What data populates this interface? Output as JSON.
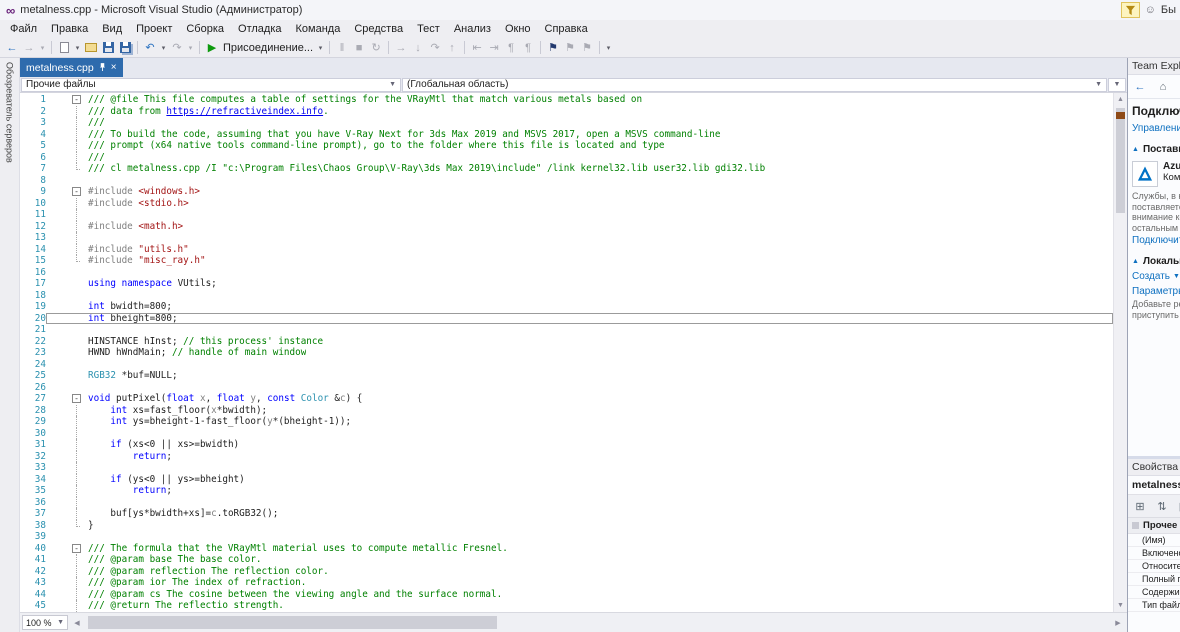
{
  "title_bar": {
    "title": "metalness.cpp - Microsoft Visual Studio  (Администратор)",
    "quick_launch": "Бы"
  },
  "menu": [
    "Файл",
    "Правка",
    "Вид",
    "Проект",
    "Сборка",
    "Отладка",
    "Команда",
    "Средства",
    "Тест",
    "Анализ",
    "Окно",
    "Справка"
  ],
  "toolbar": {
    "items": [
      {
        "n": "navigate-backward-icon",
        "g": "←",
        "c": "blu"
      },
      {
        "n": "navigate-forward-icon",
        "g": "→",
        "c": "dis"
      },
      {
        "n": "navigation-history-dropdown-icon",
        "g": "▾",
        "c": "dis",
        "s": 1
      },
      {
        "sep": 1
      },
      {
        "n": "new-file-icon",
        "shape": "page"
      },
      {
        "n": "new-file-dropdown-icon",
        "g": "▾",
        "c": "drk",
        "s": 1
      },
      {
        "n": "open-file-icon",
        "shape": "folder"
      },
      {
        "n": "save-icon",
        "shape": "floppy"
      },
      {
        "n": "save-all-icon",
        "shape": "floppy2"
      },
      {
        "sep": 1
      },
      {
        "n": "undo-icon",
        "g": "↶",
        "c": "blu"
      },
      {
        "n": "undo-dropdown-icon",
        "g": "▾",
        "c": "drk",
        "s": 1
      },
      {
        "n": "redo-icon",
        "g": "↷",
        "c": "dis"
      },
      {
        "n": "redo-dropdown-icon",
        "g": "▾",
        "c": "dis",
        "s": 1
      },
      {
        "sep": 1
      },
      {
        "n": "attach-run-icon",
        "g": "▶",
        "c": "grn"
      },
      {
        "n": "attach-label",
        "t": "Присоединение...",
        "c": "lbl"
      },
      {
        "n": "attach-dropdown-icon",
        "g": "▾",
        "c": "drk",
        "s": 1
      },
      {
        "sep": 1
      },
      {
        "n": "break-all-icon",
        "g": "‖",
        "c": "dis"
      },
      {
        "n": "stop-debug-icon",
        "g": "■",
        "c": "dis"
      },
      {
        "n": "restart-icon",
        "g": "↻",
        "c": "dis"
      },
      {
        "sep": 1
      },
      {
        "n": "show-next-statement-icon",
        "g": "→",
        "c": "dis"
      },
      {
        "n": "step-into-icon",
        "g": "↓",
        "c": "dis"
      },
      {
        "n": "step-over-icon",
        "g": "↷",
        "c": "dis"
      },
      {
        "n": "step-out-icon",
        "g": "↑",
        "c": "dis"
      },
      {
        "sep": 1
      },
      {
        "n": "shift-left-icon",
        "g": "⇤",
        "c": "dis"
      },
      {
        "n": "shift-right-icon",
        "g": "⇥",
        "c": "dis"
      },
      {
        "n": "comment-icon",
        "g": "¶",
        "c": "dis"
      },
      {
        "n": "uncomment-icon",
        "g": "¶",
        "c": "dis"
      },
      {
        "sep": 1
      },
      {
        "n": "toggle-bookmark-icon",
        "g": "⚑",
        "c": "nav"
      },
      {
        "n": "previous-bookmark-icon",
        "g": "⚑",
        "c": "dis"
      },
      {
        "n": "next-bookmark-icon",
        "g": "⚑",
        "c": "dis"
      },
      {
        "sep": 1
      },
      {
        "n": "toolbar-options-icon",
        "g": "▾",
        "c": "drk",
        "s": 1
      }
    ]
  },
  "left_strip": {
    "label": "Обозреватель серверов"
  },
  "tab": {
    "label": "metalness.cpp"
  },
  "navbar": {
    "project": "Прочие файлы",
    "scope": "(Глобальная область)"
  },
  "editor": {
    "zoom": "100 %",
    "lines": [
      {
        "n": 1,
        "f": "m",
        "s": [
          [
            "com",
            "/// @file This file computes a table of settings for the VRayMtl that match various metals based on"
          ]
        ]
      },
      {
        "n": 2,
        "f": "g",
        "s": [
          [
            "com",
            "/// data from "
          ],
          [
            "lnk",
            "https://refractiveindex.info"
          ],
          [
            "com",
            "."
          ]
        ]
      },
      {
        "n": 3,
        "f": "g",
        "s": [
          [
            "com",
            "///"
          ]
        ]
      },
      {
        "n": 4,
        "f": "g",
        "s": [
          [
            "com",
            "/// To build the code, assuming that you have V-Ray Next for 3ds Max 2019 and MSVS 2017, open a MSVS command-line"
          ]
        ]
      },
      {
        "n": 5,
        "f": "g",
        "s": [
          [
            "com",
            "/// prompt (x64 native tools command-line prompt), go to the folder where this file is located and type"
          ]
        ]
      },
      {
        "n": 6,
        "f": "g",
        "s": [
          [
            "com",
            "///"
          ]
        ]
      },
      {
        "n": 7,
        "f": "e",
        "s": [
          [
            "com",
            "/// cl metalness.cpp /I \"c:\\Program Files\\Chaos Group\\V-Ray\\3ds Max 2019\\include\" /link kernel32.lib user32.lib gdi32.lib"
          ]
        ]
      },
      {
        "n": 8,
        "s": []
      },
      {
        "n": 9,
        "f": "m",
        "s": [
          [
            "pre",
            "#include "
          ],
          [
            "str",
            "<windows.h>"
          ]
        ]
      },
      {
        "n": 10,
        "f": "g",
        "s": [
          [
            "pre",
            "#include "
          ],
          [
            "str",
            "<stdio.h>"
          ]
        ]
      },
      {
        "n": 11,
        "f": "g",
        "s": []
      },
      {
        "n": 12,
        "f": "g",
        "s": [
          [
            "pre",
            "#include "
          ],
          [
            "str",
            "<math.h>"
          ]
        ]
      },
      {
        "n": 13,
        "f": "g",
        "s": []
      },
      {
        "n": 14,
        "f": "g",
        "s": [
          [
            "pre",
            "#include "
          ],
          [
            "str",
            "\"utils.h\""
          ]
        ]
      },
      {
        "n": 15,
        "f": "e",
        "s": [
          [
            "pre",
            "#include "
          ],
          [
            "str",
            "\"misc_ray.h\""
          ]
        ]
      },
      {
        "n": 16,
        "s": []
      },
      {
        "n": 17,
        "s": [
          [
            "kw",
            "using"
          ],
          [
            "pln",
            " "
          ],
          [
            "kw",
            "namespace"
          ],
          [
            "pln",
            " VUtils;"
          ]
        ]
      },
      {
        "n": 18,
        "s": []
      },
      {
        "n": 19,
        "s": [
          [
            "kw",
            "int"
          ],
          [
            "pln",
            " bwidth=800;"
          ]
        ]
      },
      {
        "n": 20,
        "cur": true,
        "s": [
          [
            "kw",
            "int"
          ],
          [
            "pln",
            " bheight=800;"
          ]
        ]
      },
      {
        "n": 21,
        "s": []
      },
      {
        "n": 22,
        "s": [
          [
            "pln",
            "HINSTANCE hInst; "
          ],
          [
            "com",
            "// this process' instance"
          ]
        ]
      },
      {
        "n": 23,
        "s": [
          [
            "pln",
            "HWND hWndMain; "
          ],
          [
            "com",
            "// handle of main window"
          ]
        ]
      },
      {
        "n": 24,
        "s": []
      },
      {
        "n": 25,
        "s": [
          [
            "typ",
            "RGB32"
          ],
          [
            "pln",
            " *buf=NULL;"
          ]
        ]
      },
      {
        "n": 26,
        "s": []
      },
      {
        "n": 27,
        "f": "m",
        "s": [
          [
            "kw",
            "void"
          ],
          [
            "pln",
            " putPixel("
          ],
          [
            "kw",
            "float"
          ],
          [
            "gry",
            " x"
          ],
          [
            "pln",
            ", "
          ],
          [
            "kw",
            "float"
          ],
          [
            "gry",
            " y"
          ],
          [
            "pln",
            ", "
          ],
          [
            "kw",
            "const"
          ],
          [
            "typ",
            " Color"
          ],
          [
            "pln",
            " &"
          ],
          [
            "gry",
            "c"
          ],
          [
            "pln",
            ") {"
          ]
        ]
      },
      {
        "n": 28,
        "f": "g",
        "s": [
          [
            "pln",
            "    "
          ],
          [
            "kw",
            "int"
          ],
          [
            "pln",
            " xs=fast_floor("
          ],
          [
            "gry",
            "x"
          ],
          [
            "pln",
            "*bwidth);"
          ]
        ]
      },
      {
        "n": 29,
        "f": "g",
        "s": [
          [
            "pln",
            "    "
          ],
          [
            "kw",
            "int"
          ],
          [
            "pln",
            " ys=bheight-1-fast_floor("
          ],
          [
            "gry",
            "y"
          ],
          [
            "pln",
            "*(bheight-1));"
          ]
        ]
      },
      {
        "n": 30,
        "f": "g",
        "s": []
      },
      {
        "n": 31,
        "f": "g",
        "s": [
          [
            "pln",
            "    "
          ],
          [
            "kw",
            "if"
          ],
          [
            "pln",
            " (xs<0 || xs>=bwidth)"
          ]
        ]
      },
      {
        "n": 32,
        "f": "g",
        "s": [
          [
            "pln",
            "        "
          ],
          [
            "kw",
            "return"
          ],
          [
            "pln",
            ";"
          ]
        ]
      },
      {
        "n": 33,
        "f": "g",
        "s": []
      },
      {
        "n": 34,
        "f": "g",
        "s": [
          [
            "pln",
            "    "
          ],
          [
            "kw",
            "if"
          ],
          [
            "pln",
            " (ys<0 || ys>=bheight)"
          ]
        ]
      },
      {
        "n": 35,
        "f": "g",
        "s": [
          [
            "pln",
            "        "
          ],
          [
            "kw",
            "return"
          ],
          [
            "pln",
            ";"
          ]
        ]
      },
      {
        "n": 36,
        "f": "g",
        "s": []
      },
      {
        "n": 37,
        "f": "g",
        "s": [
          [
            "pln",
            "    buf[ys*bwidth+xs]="
          ],
          [
            "gry",
            "c"
          ],
          [
            "pln",
            ".toRGB32();"
          ]
        ]
      },
      {
        "n": 38,
        "f": "e",
        "s": [
          [
            "pln",
            "}"
          ]
        ]
      },
      {
        "n": 39,
        "s": []
      },
      {
        "n": 40,
        "f": "m",
        "s": [
          [
            "com",
            "/// The formula that the VRayMtl material uses to compute metallic Fresnel."
          ]
        ]
      },
      {
        "n": 41,
        "f": "g",
        "s": [
          [
            "com",
            "/// @param base The base color."
          ]
        ]
      },
      {
        "n": 42,
        "f": "g",
        "s": [
          [
            "com",
            "/// @param reflection The reflection color."
          ]
        ]
      },
      {
        "n": 43,
        "f": "g",
        "s": [
          [
            "com",
            "/// @param ior The index of refraction."
          ]
        ]
      },
      {
        "n": 44,
        "f": "g",
        "s": [
          [
            "com",
            "/// @param cs The cosine between the viewing angle and the surface normal."
          ]
        ]
      },
      {
        "n": 45,
        "f": "g",
        "s": [
          [
            "com",
            "/// @return The reflectio strength."
          ]
        ]
      }
    ]
  },
  "team_explorer": {
    "title": "Team Explorer",
    "nav_icons": [
      {
        "n": "te-back-icon",
        "g": "←",
        "c": "blu"
      },
      {
        "n": "te-home-icon",
        "g": "⌂",
        "c": "drk2"
      }
    ],
    "page_title": "Подключение",
    "manage_link": "Управление подключениями",
    "section_providers": "Поставщики размещения",
    "azure_name": "Azure",
    "azure_sub": "Команда",
    "desc_lines": [
      "Службы, в которых",
      "поставляется особое",
      "внимание команде и",
      "остальным участникам"
    ],
    "connect_link": "Подключиться",
    "section_local": "Локальные репозитории Git",
    "create_link": "Создать",
    "settings_link": "Параметры",
    "hint_lines": [
      "Добавьте репозиторий, чтобы",
      "приступить к работе."
    ]
  },
  "properties": {
    "header": "Свойства",
    "object": "metalness.cpp",
    "toolbar": [
      {
        "n": "categorized-icon",
        "g": "⊞",
        "c": "drk2"
      },
      {
        "n": "alphabetical-icon",
        "g": "⇅",
        "c": "drk2"
      },
      {
        "n": "property-pages-icon",
        "g": "▤",
        "c": "drk2"
      }
    ],
    "group": "Прочее",
    "rows": [
      "(Имя)",
      "Включено",
      "Относительный путь",
      "Полный путь",
      "Содержимое",
      "Тип файла"
    ]
  }
}
